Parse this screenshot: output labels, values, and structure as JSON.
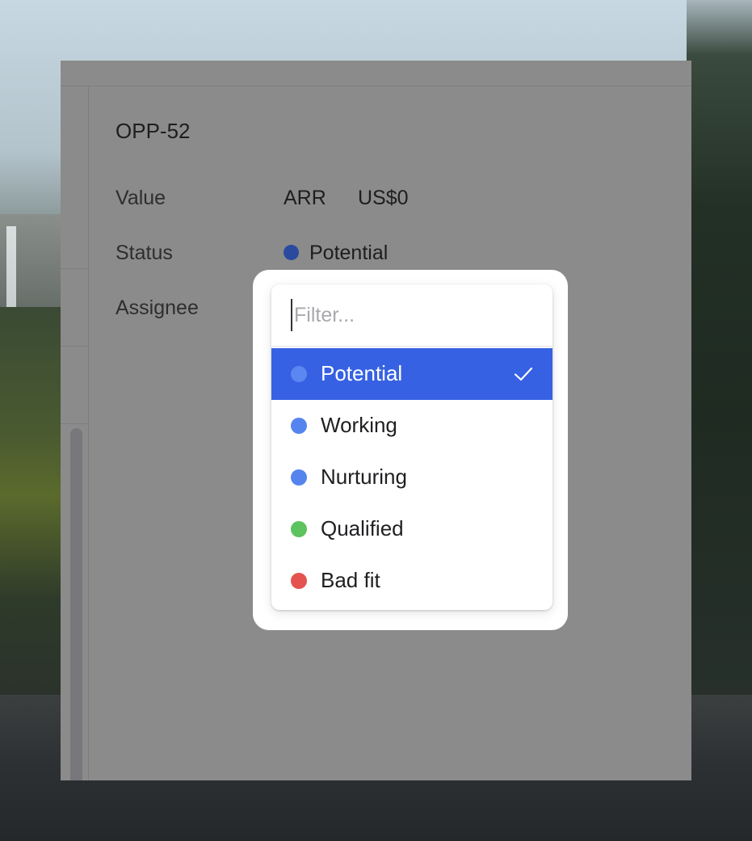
{
  "record": {
    "title": "OPP-52",
    "fields": {
      "value_label": "Value",
      "value_type": "ARR",
      "value_amount": "US$0",
      "status_label": "Status",
      "status_value": "Potential",
      "assignee_label": "Assignee"
    }
  },
  "status_dropdown": {
    "filter_placeholder": "Filter...",
    "options": [
      {
        "label": "Potential",
        "color": "#5a87f0",
        "selected": true
      },
      {
        "label": "Working",
        "color": "#5584ee",
        "selected": false
      },
      {
        "label": "Nurturing",
        "color": "#5584ee",
        "selected": false
      },
      {
        "label": "Qualified",
        "color": "#5cc35e",
        "selected": false
      },
      {
        "label": "Bad fit",
        "color": "#e4534f",
        "selected": false
      }
    ],
    "selected_icon": "checkmark-icon"
  }
}
